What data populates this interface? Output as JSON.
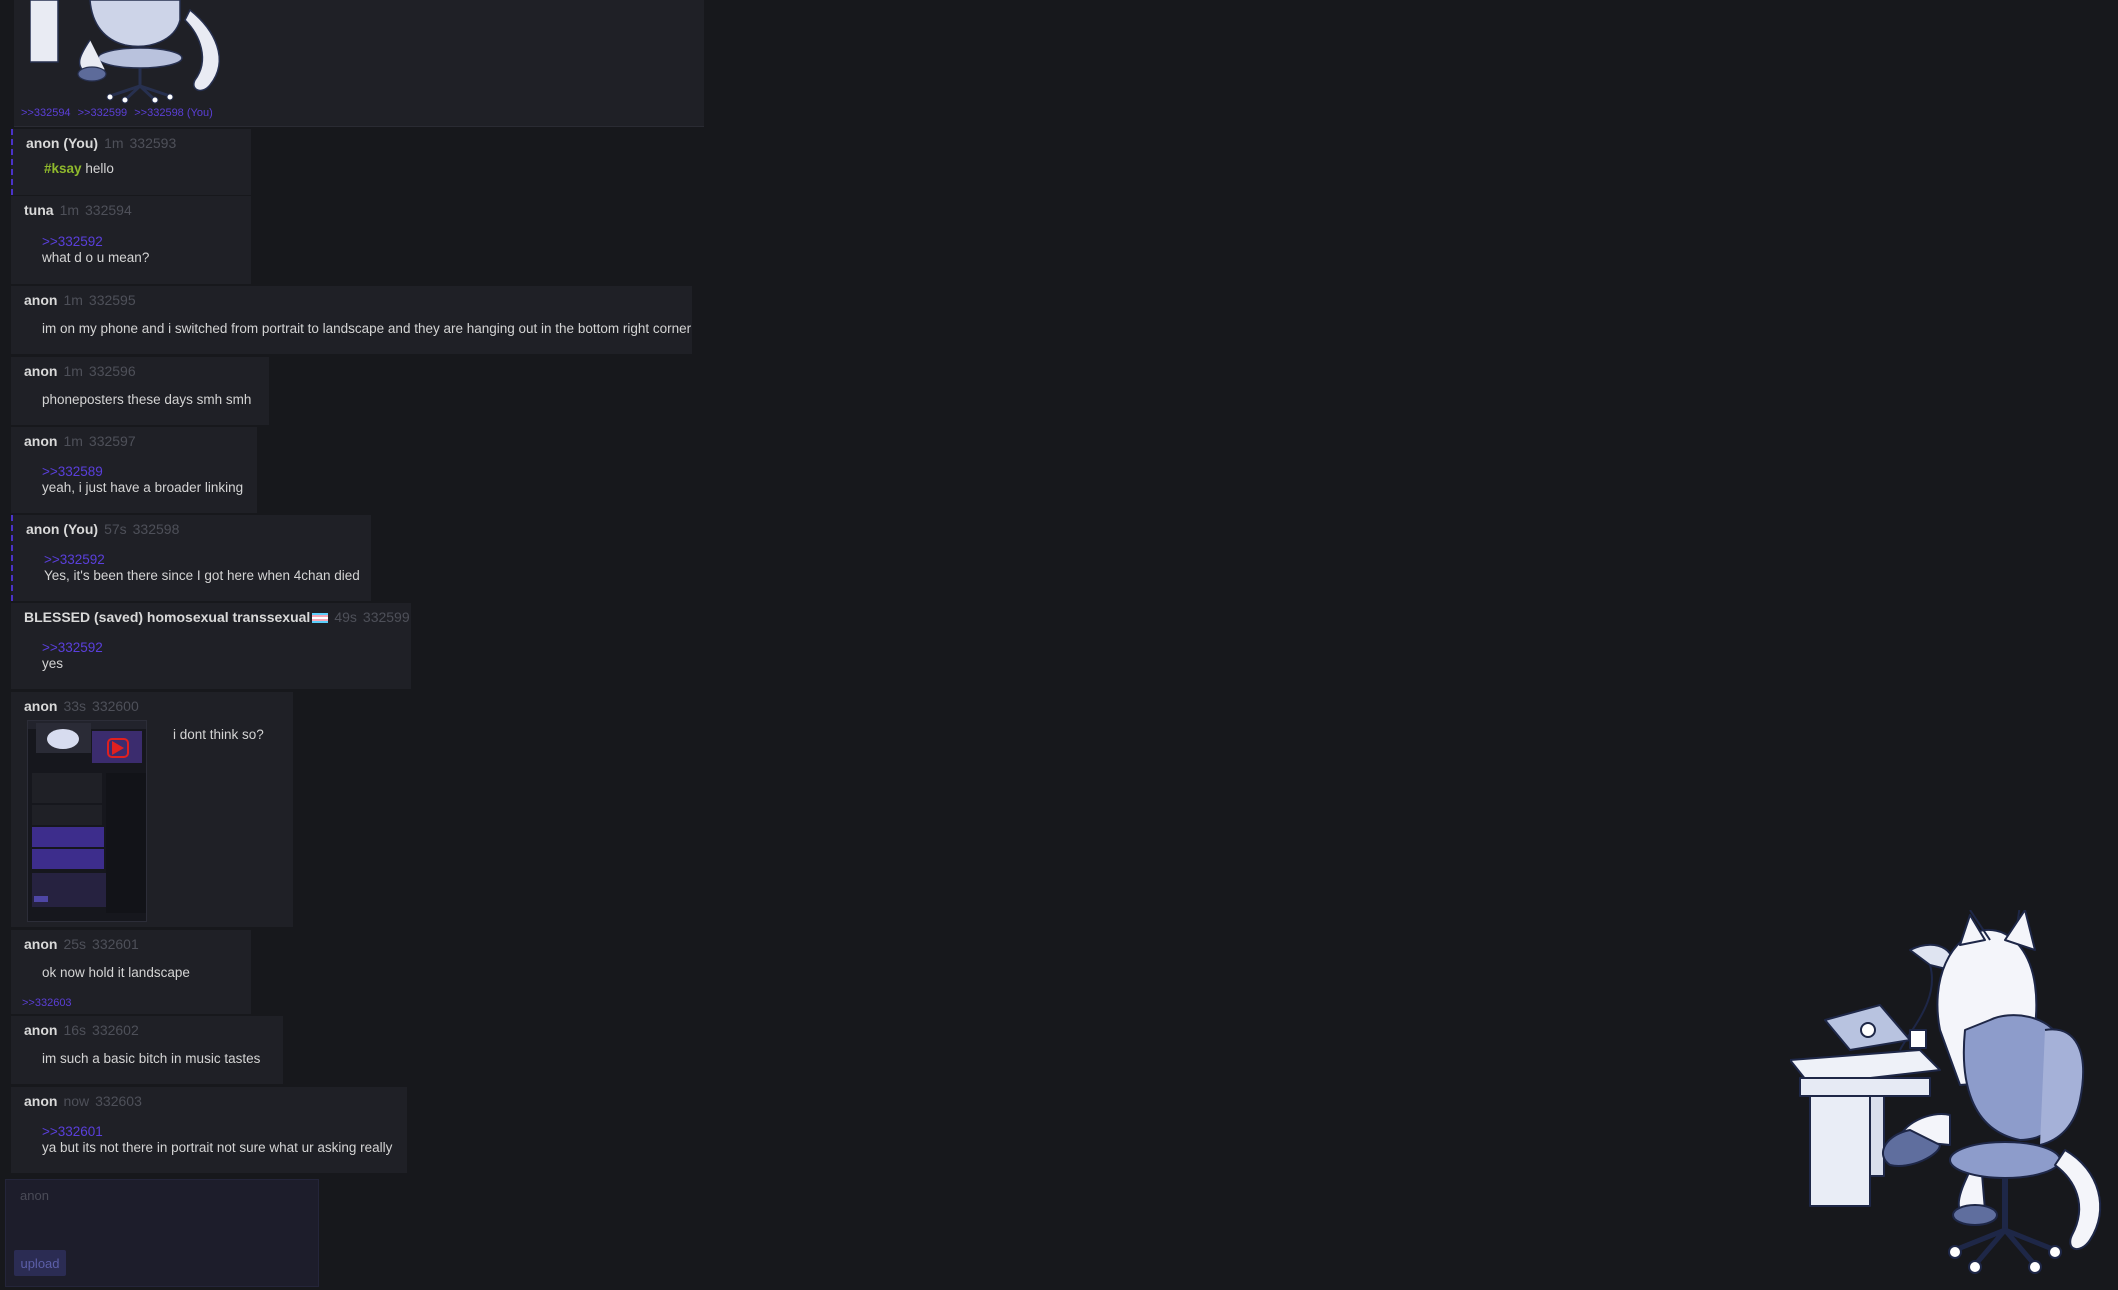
{
  "top_post": {
    "refs": [
      ">>332594",
      ">>332599",
      ">>332598 (You)"
    ]
  },
  "posts": [
    {
      "name": "anon (You)",
      "time": "1m",
      "id": "332593",
      "tag": "#ksay",
      "text": "hello"
    },
    {
      "name": "tuna",
      "time": "1m",
      "id": "332594",
      "quote": ">>332592",
      "text": "what d o u mean?"
    },
    {
      "name": "anon",
      "time": "1m",
      "id": "332595",
      "text": "im on my phone and i switched from portrait to landscape and they are hanging out in the bottom right corner"
    },
    {
      "name": "anon",
      "time": "1m",
      "id": "332596",
      "text": "phoneposters these days smh smh"
    },
    {
      "name": "anon",
      "time": "1m",
      "id": "332597",
      "quote": ">>332589",
      "text": "yeah, i just have a broader linking"
    },
    {
      "name": "anon (You)",
      "time": "57s",
      "id": "332598",
      "quote": ">>332592",
      "text": "Yes, it's been there since I got here when 4chan died"
    },
    {
      "name": "BLESSED (saved) homosexual transsexual",
      "time": "49s",
      "id": "332599",
      "quote": ">>332592",
      "text": "yes"
    },
    {
      "name": "anon",
      "time": "33s",
      "id": "332600",
      "text": "i dont think so?"
    },
    {
      "name": "anon",
      "time": "25s",
      "id": "332601",
      "text": "ok now hold it landscape",
      "reply_ref": ">>332603"
    },
    {
      "name": "anon",
      "time": "16s",
      "id": "332602",
      "text": "im such a basic bitch in music tastes"
    },
    {
      "name": "anon",
      "time": "now",
      "id": "332603",
      "quote": ">>332601",
      "text": "ya but its not there in portrait not sure what ur asking really"
    }
  ],
  "reply_form": {
    "name_placeholder": "anon",
    "upload_label": "upload"
  },
  "colors": {
    "background": "#17181c",
    "post_bg": "#1f2026",
    "quote_link": "#5a3fdc",
    "tag": "#8fb92c",
    "meta": "#4e5059"
  }
}
